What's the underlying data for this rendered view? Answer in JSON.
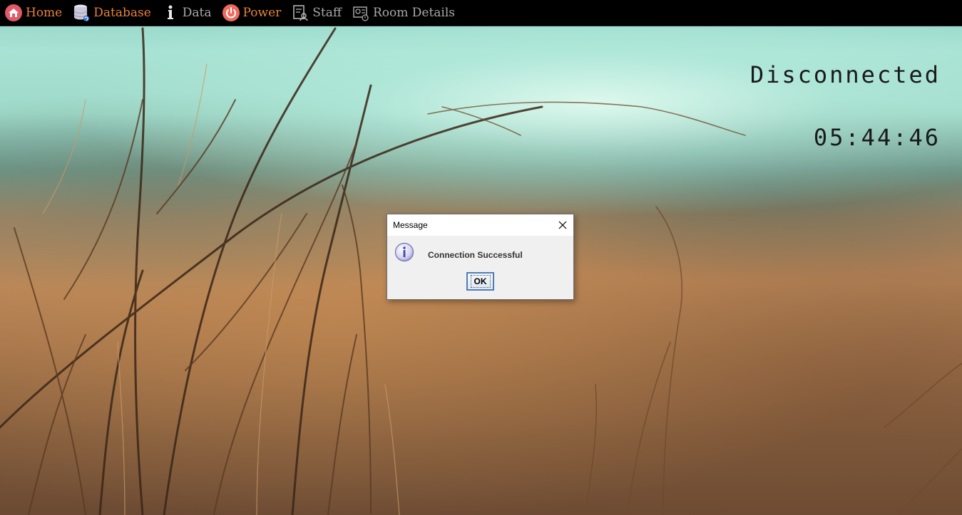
{
  "navbar": {
    "items": [
      {
        "label": "Home",
        "icon": "home-icon"
      },
      {
        "label": "Database",
        "icon": "database-icon"
      },
      {
        "label": "Data",
        "icon": "info-icon"
      },
      {
        "label": "Power",
        "icon": "power-icon"
      },
      {
        "label": "Staff",
        "icon": "staff-icon"
      },
      {
        "label": "Room Details",
        "icon": "room-details-icon"
      }
    ]
  },
  "status": {
    "connection": "Disconnected",
    "time": "05:44:46"
  },
  "dialog": {
    "title": "Message",
    "message": "Connection Successful",
    "ok_label": "OK",
    "icon": "information-icon"
  },
  "colors": {
    "nav_accent": "#e8833a",
    "nav_muted": "#a9a9a9",
    "navbar_bg": "#000000",
    "status_text": "#1a1a1a"
  }
}
